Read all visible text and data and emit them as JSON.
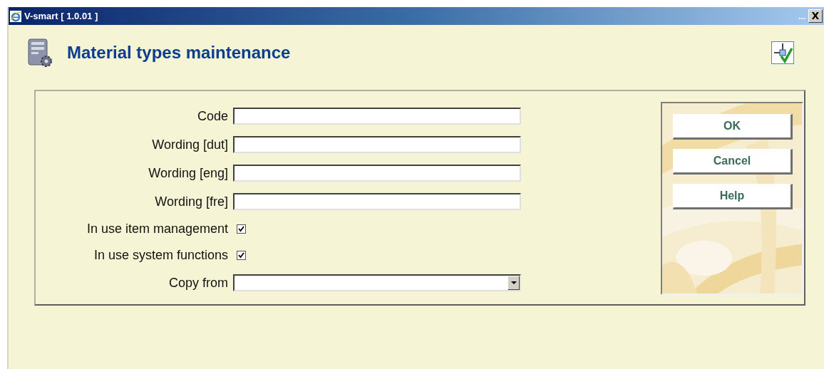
{
  "window": {
    "title": "V-smart [ 1.0.01 ]",
    "more": "...",
    "close": "X"
  },
  "page": {
    "heading": "Material types maintenance"
  },
  "fields": [
    {
      "kind": "text",
      "label": "Code"
    },
    {
      "kind": "text",
      "label": "Wording [dut]"
    },
    {
      "kind": "text",
      "label": "Wording [eng]"
    },
    {
      "kind": "text",
      "label": "Wording [fre]"
    },
    {
      "kind": "checkbox",
      "label": "In use item management",
      "checked": true
    },
    {
      "kind": "checkbox",
      "label": "In use system functions",
      "checked": true
    },
    {
      "kind": "select",
      "label": "Copy from"
    }
  ],
  "buttons": [
    "OK",
    "Cancel",
    "Help"
  ]
}
